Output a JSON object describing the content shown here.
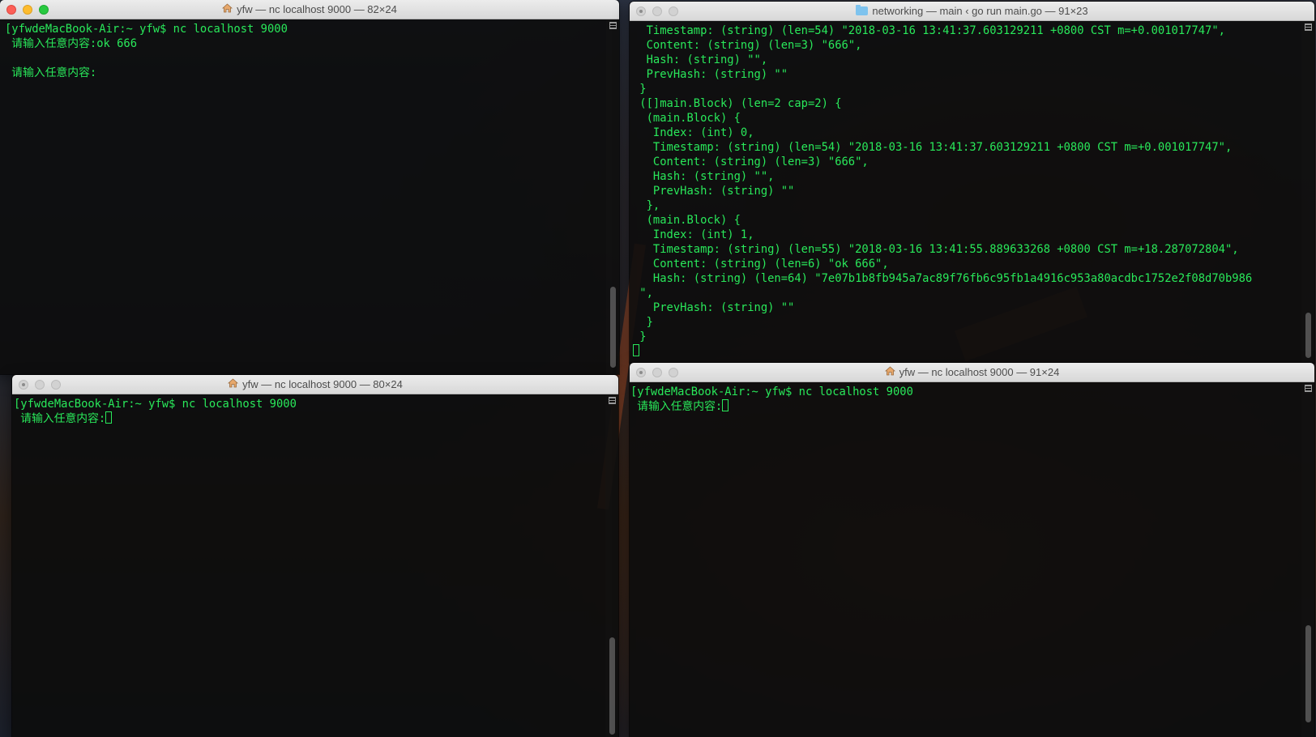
{
  "windows": [
    {
      "id": "top-left",
      "title": "yfw — nc localhost 9000 — 82×24",
      "icon": "home-icon",
      "active": true,
      "lines": [
        "[yfwdeMacBook-Air:~ yfw$ nc localhost 9000",
        " 请输入任意内容:ok 666",
        "",
        " 请输入任意内容:"
      ]
    },
    {
      "id": "top-right",
      "title": "networking — main ‹ go run main.go — 91×23",
      "icon": "folder-icon",
      "active": false,
      "lines": [
        "  Timestamp: (string) (len=54) \"2018-03-16 13:41:37.603129211 +0800 CST m=+0.001017747\",",
        "  Content: (string) (len=3) \"666\",",
        "  Hash: (string) \"\",",
        "  PrevHash: (string) \"\"",
        " }",
        " ([]main.Block) (len=2 cap=2) {",
        "  (main.Block) {",
        "   Index: (int) 0,",
        "   Timestamp: (string) (len=54) \"2018-03-16 13:41:37.603129211 +0800 CST m=+0.001017747\",",
        "   Content: (string) (len=3) \"666\",",
        "   Hash: (string) \"\",",
        "   PrevHash: (string) \"\"",
        "  },",
        "  (main.Block) {",
        "   Index: (int) 1,",
        "   Timestamp: (string) (len=55) \"2018-03-16 13:41:55.889633268 +0800 CST m=+18.287072804\",",
        "   Content: (string) (len=6) \"ok 666\",",
        "   Hash: (string) (len=64) \"7e07b1b8fb945a7ac89f76fb6c95fb1a4916c953a80acdbc1752e2f08d70b986",
        " \",",
        "   PrevHash: (string) \"\"",
        "  }",
        " }"
      ]
    },
    {
      "id": "bottom-left",
      "title": "yfw — nc localhost 9000 — 80×24",
      "icon": "home-icon",
      "active": false,
      "lines": [
        "[yfwdeMacBook-Air:~ yfw$ nc localhost 9000",
        " 请输入任意内容:"
      ]
    },
    {
      "id": "bottom-right",
      "title": "yfw — nc localhost 9000 — 91×24",
      "icon": "home-icon",
      "active": false,
      "lines": [
        "[yfwdeMacBook-Air:~ yfw$ nc localhost 9000",
        " 请输入任意内容:"
      ]
    }
  ],
  "colors": {
    "terminal_text": "#29e85a",
    "terminal_bg": "#0c0c0c",
    "titlebar": "#e4e4e4",
    "close": "#fc5f57",
    "minimize": "#fdbc2e",
    "zoom": "#28c940",
    "folder": "#7ec3ee"
  }
}
